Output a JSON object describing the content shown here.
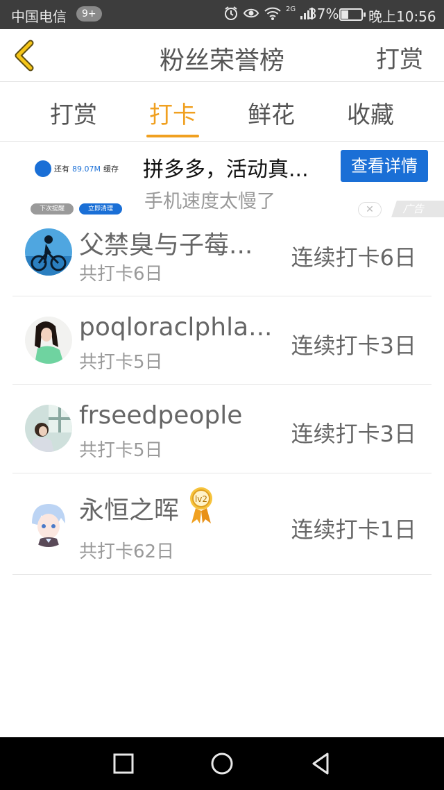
{
  "status_bar": {
    "carrier": "中国电信",
    "notification_badge": "9+",
    "network_label": "2G",
    "battery_percent": "37%",
    "battery_level": 0.37,
    "time": "晚上10:56",
    "icons": [
      "alarm-icon",
      "eye-icon",
      "wifi-icon",
      "signal-icon",
      "battery-icon"
    ]
  },
  "header": {
    "title": "粉丝荣誉榜",
    "action_label": "打赏",
    "back_icon": "chevron-left-icon",
    "accent_color": "#f0a020"
  },
  "tabs": [
    {
      "label": "打赏",
      "active": false
    },
    {
      "label": "打卡",
      "active": true
    },
    {
      "label": "鲜花",
      "active": false
    },
    {
      "label": "收藏",
      "active": false
    }
  ],
  "ad": {
    "storage_prefix": "还有",
    "storage_amount": "89.07M",
    "storage_suffix": "缓存",
    "later_label": "下次提醒",
    "clean_label": "立即清理",
    "headline": "拼多多，活动真...",
    "cta_label": "查看详情",
    "subtitle": "手机速度太慢了",
    "close_symbol": "✕",
    "ad_tag": "广告",
    "cta_color": "#1a6fd6"
  },
  "rank_list": [
    {
      "name": "父禁臭与子莓...",
      "total": "共打卡6日",
      "streak": "连续打卡6日",
      "avatar": "cyclist-avatar",
      "badge": ""
    },
    {
      "name": "poqloraclphla...",
      "total": "共打卡5日",
      "streak": "连续打卡3日",
      "avatar": "girl-avatar",
      "badge": ""
    },
    {
      "name": "frseedpeople",
      "total": "共打卡5日",
      "streak": "连续打卡3日",
      "avatar": "window-girl-avatar",
      "badge": ""
    },
    {
      "name": "永恒之晖",
      "total": "共打卡62日",
      "streak": "连续打卡1日",
      "avatar": "anime-avatar",
      "badge": "lv2"
    }
  ],
  "nav_bar": {
    "icons": [
      "square-recent-icon",
      "circle-home-icon",
      "triangle-back-icon"
    ]
  }
}
